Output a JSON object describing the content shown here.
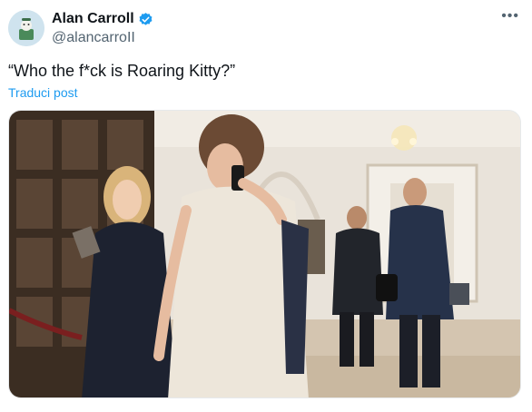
{
  "author": {
    "display_name": "Alan Carroll",
    "handle": "@alancarroII",
    "verified": true,
    "avatar_icon": "cartoon-avatar"
  },
  "tweet": {
    "text": "“Who the f*ck is Roaring Kitty?”",
    "translate_label": "Traduci post",
    "more_icon": "more-options-icon"
  },
  "media": {
    "type": "photo"
  },
  "colors": {
    "accent": "#1d9bf0",
    "text": "#0f1419",
    "muted": "#536471"
  }
}
